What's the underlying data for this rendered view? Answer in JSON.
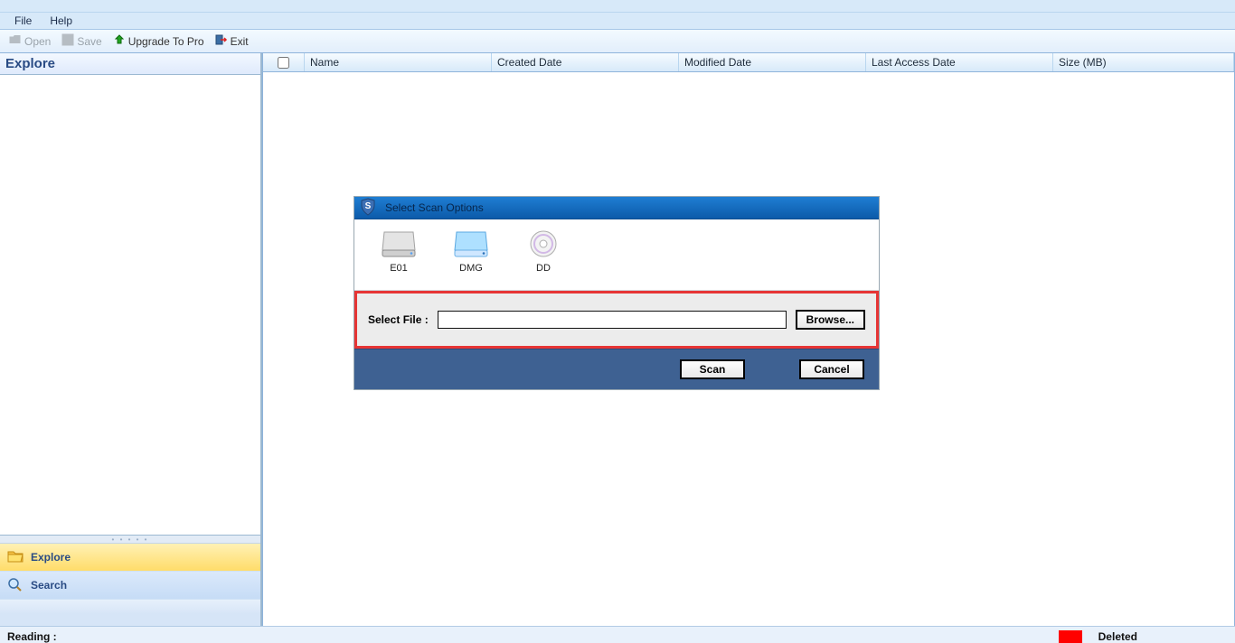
{
  "menu": {
    "file": "File",
    "help": "Help"
  },
  "toolbar": {
    "open": "Open",
    "save": "Save",
    "upgrade": "Upgrade To Pro",
    "exit": "Exit"
  },
  "left": {
    "header": "Explore",
    "nav": {
      "explore": "Explore",
      "search": "Search"
    }
  },
  "columns": {
    "name": "Name",
    "created": "Created Date",
    "modified": "Modified Date",
    "lastaccess": "Last Access Date",
    "size": "Size (MB)"
  },
  "dialog": {
    "title": "Select Scan Options",
    "formats": {
      "e01": "E01",
      "dmg": "DMG",
      "dd": "DD"
    },
    "select_file_label": "Select  File  :",
    "file_value": "",
    "browse": "Browse...",
    "scan": "Scan",
    "cancel": "Cancel"
  },
  "status": {
    "reading": "Reading :",
    "deleted": "Deleted"
  }
}
